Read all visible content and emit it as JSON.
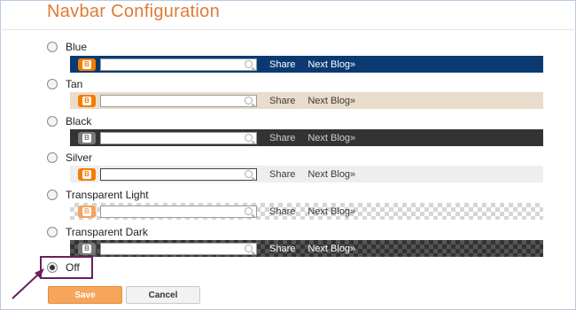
{
  "header": {
    "title": "Navbar Configuration"
  },
  "options": [
    {
      "label": "Blue",
      "checked": false
    },
    {
      "label": "Tan",
      "checked": false
    },
    {
      "label": "Black",
      "checked": false
    },
    {
      "label": "Silver",
      "checked": false
    },
    {
      "label": "Transparent Light",
      "checked": false
    },
    {
      "label": "Transparent Dark",
      "checked": false
    },
    {
      "label": "Off",
      "checked": true
    }
  ],
  "navbar_preview": {
    "share_label": "Share",
    "next_blog_label": "Next Blog»",
    "logo_letter": "B"
  },
  "actions": {
    "save_label": "Save",
    "cancel_label": "Cancel"
  },
  "colors": {
    "title": "#e07a36",
    "blue_bar": "#0b3a73",
    "tan_bar": "#e9dccb",
    "black_bar": "#333333",
    "silver_bar": "#eeeeee",
    "save_button": "#f6a55a",
    "highlight": "#6b1f5c"
  }
}
